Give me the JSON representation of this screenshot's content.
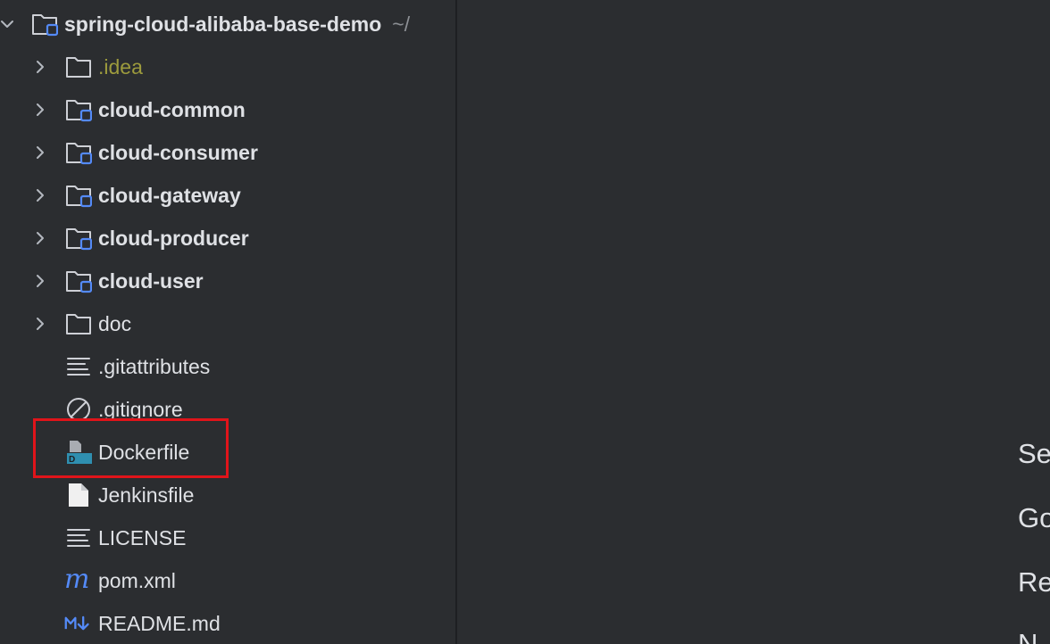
{
  "tree": {
    "root": {
      "label": "spring-cloud-alibaba-base-demo",
      "suffix": "~/"
    },
    "items": [
      {
        "label": ".idea",
        "icon": "folder-icon",
        "expandable": true
      },
      {
        "label": "cloud-common",
        "icon": "module-folder-icon",
        "expandable": true
      },
      {
        "label": "cloud-consumer",
        "icon": "module-folder-icon",
        "expandable": true
      },
      {
        "label": "cloud-gateway",
        "icon": "module-folder-icon",
        "expandable": true
      },
      {
        "label": "cloud-producer",
        "icon": "module-folder-icon",
        "expandable": true
      },
      {
        "label": "cloud-user",
        "icon": "module-folder-icon",
        "expandable": true
      },
      {
        "label": "doc",
        "icon": "folder-icon",
        "expandable": true
      },
      {
        "label": ".gitattributes",
        "icon": "text-file-icon",
        "expandable": false
      },
      {
        "label": ".gitignore",
        "icon": "ignore-file-icon",
        "expandable": false
      },
      {
        "label": "Dockerfile",
        "icon": "docker-file-icon",
        "expandable": false
      },
      {
        "label": "Jenkinsfile",
        "icon": "generic-file-icon",
        "expandable": false
      },
      {
        "label": "LICENSE",
        "icon": "text-file-icon",
        "expandable": false
      },
      {
        "label": "pom.xml",
        "icon": "maven-icon",
        "expandable": false
      },
      {
        "label": "README.md",
        "icon": "markdown-icon",
        "expandable": false
      }
    ]
  },
  "editor_hints": [
    "Se",
    "Go",
    "Re",
    "N"
  ],
  "colors": {
    "background": "#2b2d30",
    "text": "#dfe1e5",
    "muted": "#8c8f94",
    "idea_folder": "#9d9b3d",
    "module_badge": "#548af7",
    "highlight": "#e0141a"
  }
}
